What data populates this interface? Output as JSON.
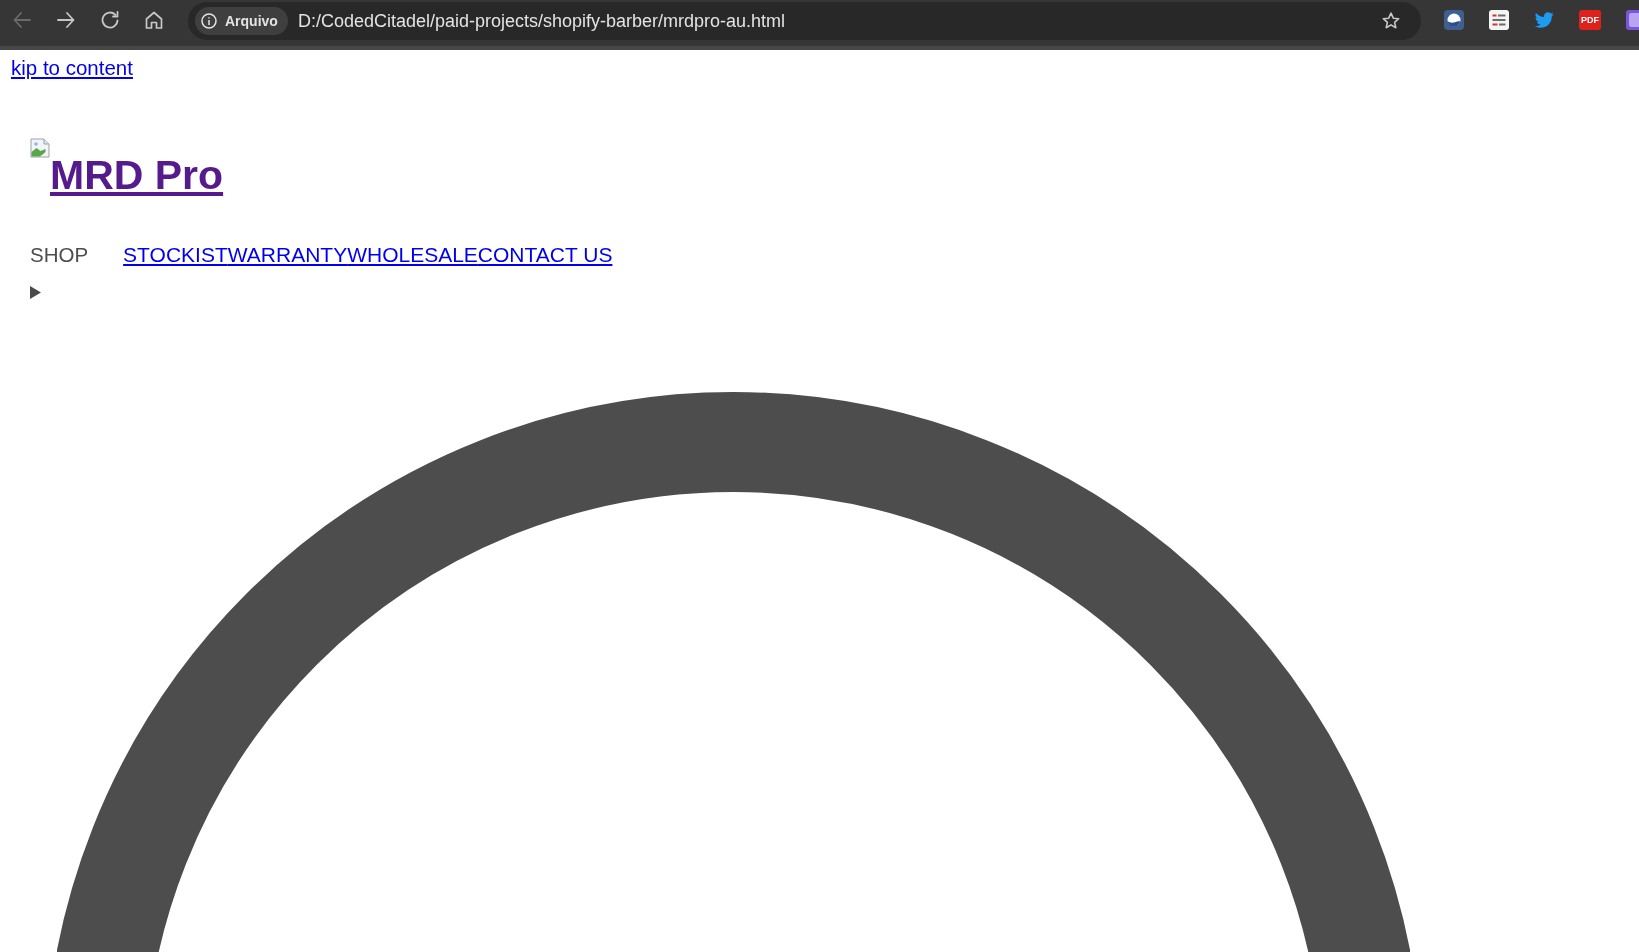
{
  "browser": {
    "back_button": {
      "disabled": true
    },
    "forward_button": {
      "disabled": false
    },
    "site_info": {
      "label": "Arquivo"
    },
    "address": "D:/CodedCitadel/paid-projects/shopify-barber/mrdpro-au.html",
    "extensions": {
      "pdf_label": "PDF"
    }
  },
  "page": {
    "skip_link": {
      "label": "kip to content",
      "visited": false
    },
    "logo": {
      "alt_text": "MRD Pro",
      "visited": true
    },
    "nav": [
      {
        "kind": "text",
        "label": "SHOP"
      },
      {
        "kind": "link",
        "label": "STOCKIST",
        "visited": false
      },
      {
        "kind": "link",
        "label": "WARRANTY",
        "visited": false
      },
      {
        "kind": "link",
        "label": "WHOLESALE",
        "visited": false
      },
      {
        "kind": "link",
        "label": "CONTACT US",
        "visited": false
      }
    ],
    "submenu": {
      "expanded": false
    }
  }
}
